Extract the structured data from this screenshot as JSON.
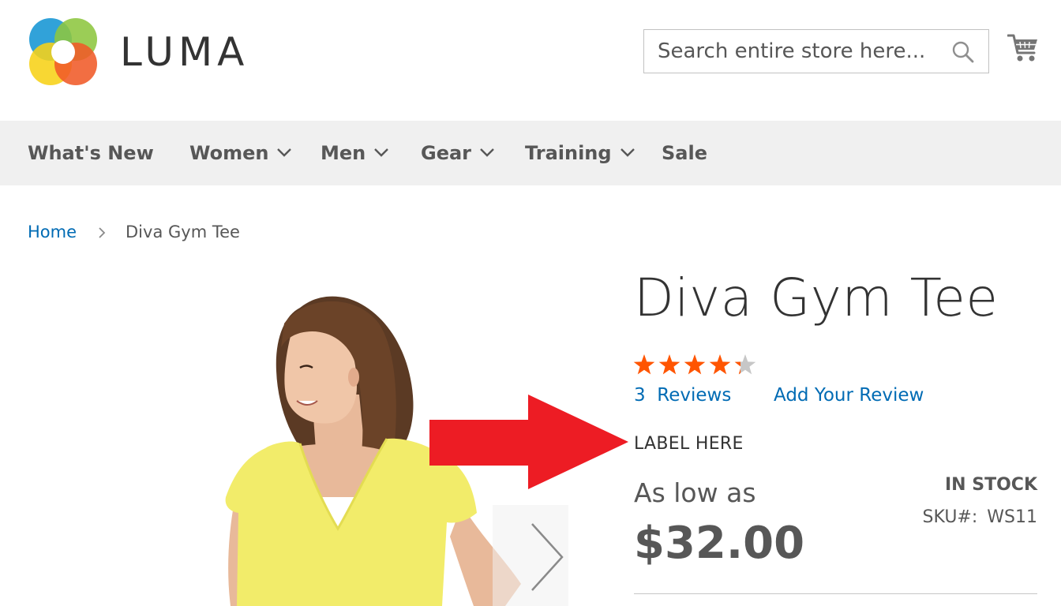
{
  "header": {
    "logo_text": "LUMA",
    "search": {
      "placeholder": "Search entire store here..."
    },
    "icons": {
      "search": "search-icon",
      "cart": "shopping-cart-icon"
    }
  },
  "nav": {
    "items": [
      {
        "label": "What's New",
        "has_dropdown": false
      },
      {
        "label": "Women",
        "has_dropdown": true
      },
      {
        "label": "Men",
        "has_dropdown": true
      },
      {
        "label": "Gear",
        "has_dropdown": true
      },
      {
        "label": "Training",
        "has_dropdown": true
      },
      {
        "label": "Sale",
        "has_dropdown": false
      }
    ]
  },
  "breadcrumb": {
    "home": "Home",
    "current": "Diva Gym Tee"
  },
  "product": {
    "title": "Diva Gym Tee",
    "rating": {
      "score": 4.5,
      "max": 5
    },
    "reviews_count": "3",
    "reviews_label": "Reviews",
    "add_review_label": "Add Your Review",
    "custom_label": "LABEL HERE",
    "price_prefix": "As low as",
    "price": "$32.00",
    "stock_status": "IN STOCK",
    "sku_label": "SKU#:",
    "sku": "WS11"
  },
  "colors": {
    "link": "#006bb4",
    "star_filled": "#ff5501",
    "star_empty": "#c7c7c7",
    "annotation_arrow": "#ed1c24",
    "nav_background": "#f0f0f0",
    "text_muted": "#575757",
    "shirt": "#f2ec6a"
  }
}
